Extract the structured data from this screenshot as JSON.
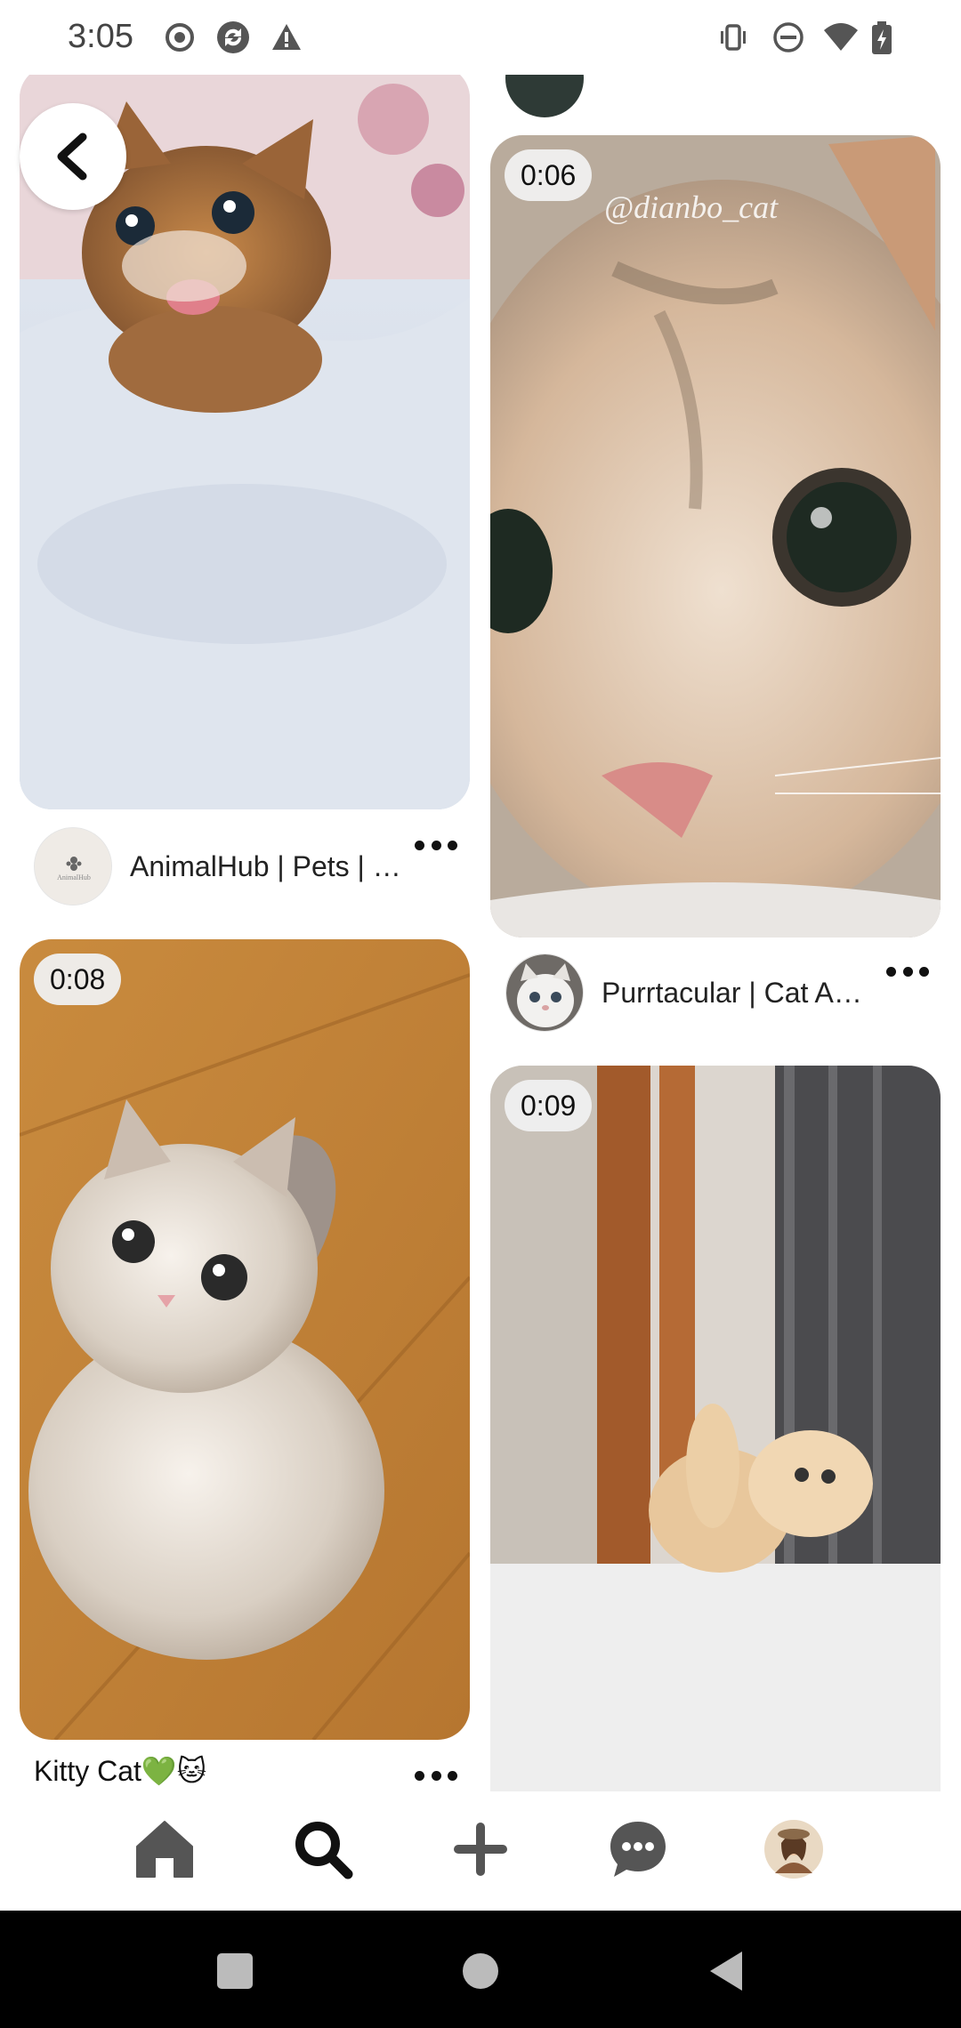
{
  "status_bar": {
    "time": "3:05",
    "left_icons": [
      "record-icon",
      "sync-icon",
      "warning-icon"
    ],
    "right_icons": [
      "vibrate-icon",
      "do-not-disturb-icon",
      "wifi-icon",
      "battery-charging-icon"
    ]
  },
  "feed": {
    "pins": [
      {
        "id": "pin-1",
        "duration": "",
        "attribution": "AnimalHub | Pets | …",
        "avatar_text": "AnimalHub"
      },
      {
        "id": "pin-2",
        "duration": "0:06",
        "watermark": "@dianbo_cat",
        "attribution": "Purrtacular | Cat A…"
      },
      {
        "id": "pin-3",
        "duration": "0:08",
        "title": "Kitty Cat💚🐱"
      },
      {
        "id": "pin-4",
        "duration": "0:09"
      }
    ]
  },
  "bottom_nav": {
    "items": [
      "home-icon",
      "search-icon",
      "create-icon",
      "messages-icon",
      "profile-avatar"
    ],
    "active": "search-icon"
  },
  "system_nav": {
    "buttons": [
      "recents",
      "home",
      "back"
    ]
  },
  "colors": {
    "accent": "#111111",
    "background": "#ffffff",
    "badge_bg": "#f0f0f0"
  }
}
